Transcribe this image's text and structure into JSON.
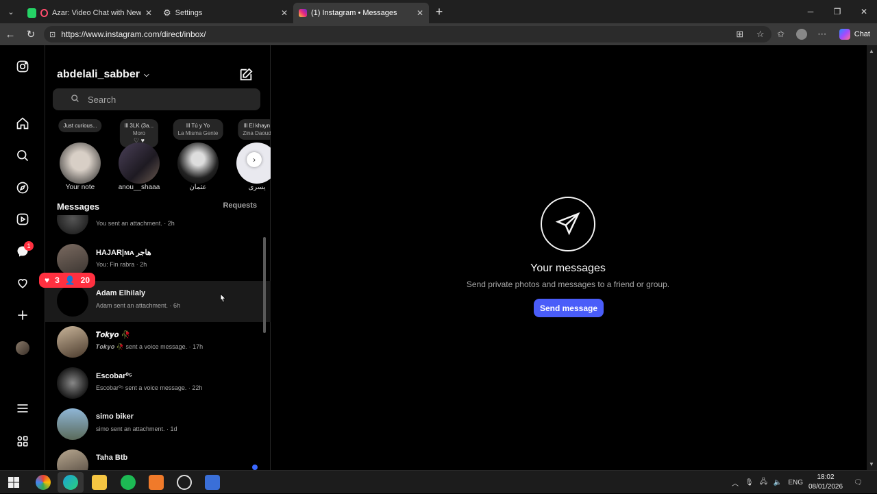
{
  "browser": {
    "tabs": [
      {
        "title": "Azar: Video Chat with New Pe",
        "active": false
      },
      {
        "title": "Settings",
        "active": false
      },
      {
        "title": "(1) Instagram • Messages",
        "active": true
      }
    ],
    "url": "https://www.instagram.com/direct/inbox/",
    "chat_label": "Chat"
  },
  "instagram": {
    "notification_count": "1",
    "username": "abdelali_sabber",
    "search_placeholder": "Search",
    "notes": [
      {
        "text": "Just curious...",
        "sub": "",
        "name": "Your note"
      },
      {
        "text": "lll 3LK (3a...",
        "sub": "Moro",
        "name": "anou__shaaa"
      },
      {
        "text": "lll Tú y Yo",
        "sub": "La Misma Gente",
        "name": "عثمان"
      },
      {
        "text": "lll El khayn",
        "sub": "Zina Daoud",
        "name": "يسرى"
      }
    ],
    "messages_title": "Messages",
    "requests_label": "Requests",
    "threads": [
      {
        "name": "",
        "preview": "You sent an attachment. · 2h"
      },
      {
        "name": "HAJAR|ᴍᴀ هاجر",
        "preview": "You: Fin rabra · 2h"
      },
      {
        "name": "Adam Elhilaly",
        "preview": "Adam sent an attachment. · 6h"
      },
      {
        "name": "𝑻𝒐𝒌𝒚𝒐 🥀",
        "preview": "𝑻𝒐𝒌𝒚𝒐 🥀 sent a voice message. · 17h"
      },
      {
        "name": "Escobar⁰⁵",
        "preview": "Escobar⁰⁵ sent a voice message. · 22h"
      },
      {
        "name": "simo biker",
        "preview": "simo sent an attachment. · 1d"
      },
      {
        "name": "Taha Btb",
        "preview": ""
      }
    ],
    "reaction_popup": {
      "likes": "3",
      "follows": "20"
    },
    "empty_state": {
      "title": "Your messages",
      "subtitle": "Send private photos and messages to a friend or group.",
      "button": "Send message"
    }
  },
  "taskbar": {
    "language": "ENG",
    "time": "18:02",
    "date": "08/01/2026"
  }
}
